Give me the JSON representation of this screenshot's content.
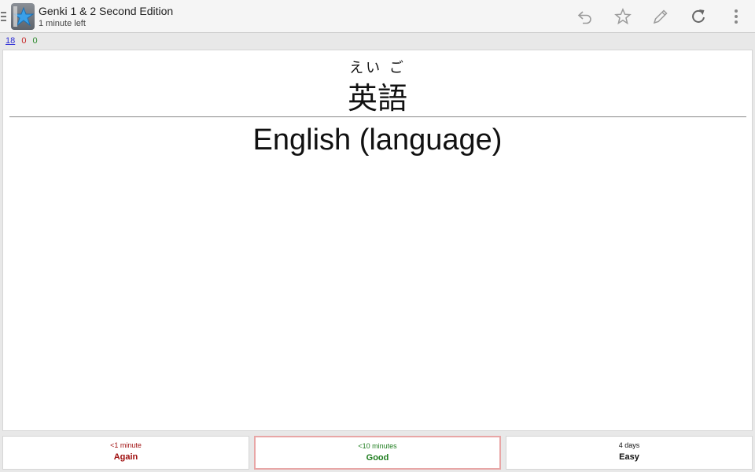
{
  "app": {
    "title": "Genki 1 & 2 Second Edition",
    "subtitle": "1 minute left",
    "icon": "anki-star-icon"
  },
  "toolbar": {
    "actions": [
      "undo-icon",
      "star-icon",
      "edit-pencil-icon",
      "replay-icon",
      "overflow-menu-icon"
    ]
  },
  "counts": {
    "new": "18",
    "learning": "0",
    "review": "0"
  },
  "card": {
    "furigana": "えい ご",
    "kanji": "英語",
    "meaning": "English (language)"
  },
  "answers": {
    "again": {
      "interval": "<1 minute",
      "label": "Again"
    },
    "good": {
      "interval": "<10 minutes",
      "label": "Good"
    },
    "easy": {
      "interval": "4 days",
      "label": "Easy"
    }
  },
  "colors": {
    "again": "#a01010",
    "good": "#1e7d1e",
    "new_count": "#2b2bd6",
    "learning_count": "#c62828",
    "review_count": "#2e8b2e"
  }
}
